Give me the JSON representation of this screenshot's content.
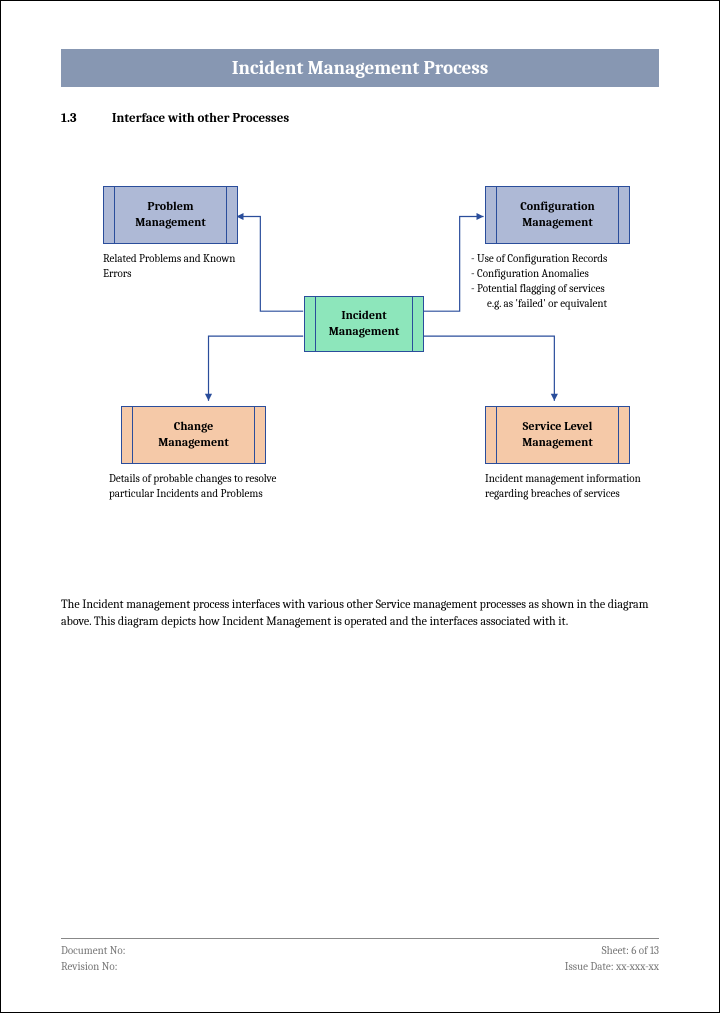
{
  "title": "Incident Management Process",
  "section": {
    "number": "1.3",
    "heading": "Interface with other Processes"
  },
  "diagram": {
    "problem": {
      "label": "Problem\nManagement",
      "caption": "Related Problems and Known Errors"
    },
    "configuration": {
      "label": "Configuration\nManagement",
      "bullets": [
        "Use of Configuration Records",
        "Configuration Anomalies",
        "Potential flagging of services"
      ],
      "bullet_indent": "e.g. as 'failed' or equivalent"
    },
    "incident": {
      "label": "Incident\nManagement"
    },
    "change": {
      "label": "Change\nManagement",
      "caption": "Details of probable changes to resolve particular Incidents and Problems"
    },
    "servicelevel": {
      "label": "Service Level\nManagement",
      "caption": "Incident management information regarding breaches of services"
    }
  },
  "body": "The Incident management process interfaces with various other Service management processes as shown in the diagram above. This diagram depicts how Incident Management is operated and the interfaces associated with it.",
  "footer": {
    "doc_no": "Document No:",
    "rev_no": "Revision No:",
    "sheet": "Sheet: 6 of 13",
    "issue": "Issue Date: xx-xxx-xx"
  }
}
